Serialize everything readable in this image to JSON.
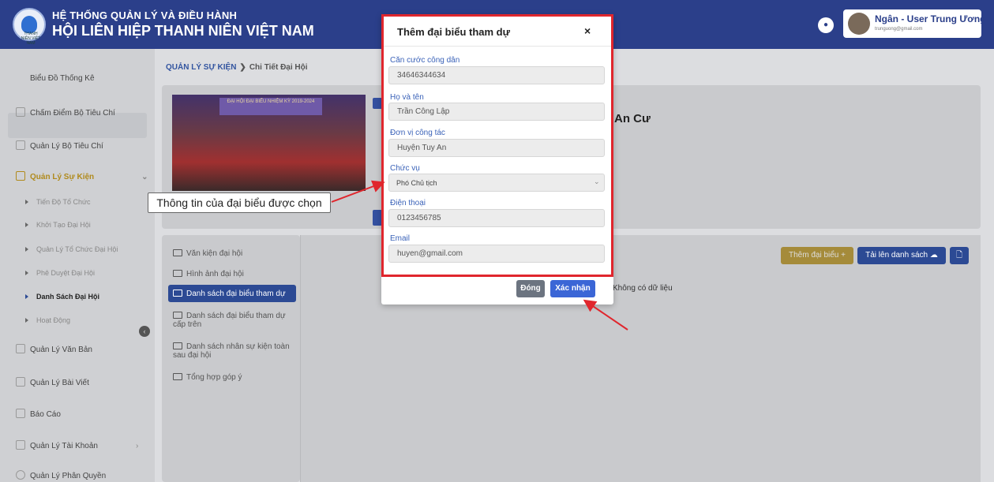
{
  "header": {
    "title_line1": "HỆ THỐNG QUẢN LÝ VÀ ĐIỀU HÀNH",
    "title_line2": "HỘI LIÊN HIỆP THANH NIÊN VIỆT NAM",
    "logo_text": "THANH NIÊN VIỆT NAM",
    "user_name": "Ngân - User Trung Ương",
    "user_email": "trunguong@gmail.com"
  },
  "sidebar": {
    "items": [
      {
        "label": "Biểu Đồ Thống Kê"
      },
      {
        "label": "Chấm Điểm Bộ Tiêu Chí"
      },
      {
        "label": "Quản Lý Bộ Tiêu Chí"
      },
      {
        "label": "Quản Lý Sự Kiện"
      },
      {
        "label": "Quản Lý Văn Bản"
      },
      {
        "label": "Quản Lý Bài Viết"
      },
      {
        "label": "Báo Cáo"
      },
      {
        "label": "Quản Lý Tài Khoản"
      },
      {
        "label": "Quản Lý Phân Quyền"
      }
    ],
    "subitems": [
      {
        "label": "Tiến Độ Tổ Chức"
      },
      {
        "label": "Khởi Tạo Đại Hội"
      },
      {
        "label": "Quản Lý Tổ Chức Đại Hội"
      },
      {
        "label": "Phê Duyệt Đại Hội"
      },
      {
        "label": "Danh Sách Đại Hội"
      },
      {
        "label": "Hoạt Động"
      }
    ]
  },
  "breadcrumb": {
    "section": "QUẢN LÝ SỰ KIỆN",
    "current": "Chi Tiết Đại Hội"
  },
  "event": {
    "banner": "ĐẠI HỘI ĐẠI BIỂU NHIỆM KỲ 2019-2024",
    "title_fragment": "An Cư"
  },
  "folders": [
    {
      "label": "Văn kiện đại hội"
    },
    {
      "label": "Hình ảnh đại hội"
    },
    {
      "label": "Danh sách đại biểu tham dự"
    },
    {
      "label": "Danh sách đại biểu tham dự cấp trên"
    },
    {
      "label": "Danh sách nhân sự kiện toàn sau đại hội"
    },
    {
      "label": "Tổng hợp góp ý"
    }
  ],
  "actions": {
    "add_delegate": "Thêm đại biểu +",
    "upload_list": "Tải lên danh sách ☁",
    "doc": "🗋",
    "no_data": "Không có dữ liệu"
  },
  "callout": "Thông tin của đại biểu được chọn",
  "modal": {
    "title": "Thêm đại biểu tham dự",
    "close": "×",
    "fields": {
      "cccd": {
        "label": "Căn cước công dân",
        "value": "34646344634"
      },
      "name": {
        "label": "Họ và tên",
        "value": "Trần Công Lập"
      },
      "unit": {
        "label": "Đơn vị công tác",
        "value": "Huyện Tuy An"
      },
      "position": {
        "label": "Chức vụ",
        "value": "Phó Chủ tịch"
      },
      "phone": {
        "label": "Điện thoại",
        "value": "0123456785"
      },
      "email": {
        "label": "Email",
        "value": "huyen@gmail.com"
      }
    },
    "btn_close": "Đóng",
    "btn_confirm": "Xác nhận"
  }
}
